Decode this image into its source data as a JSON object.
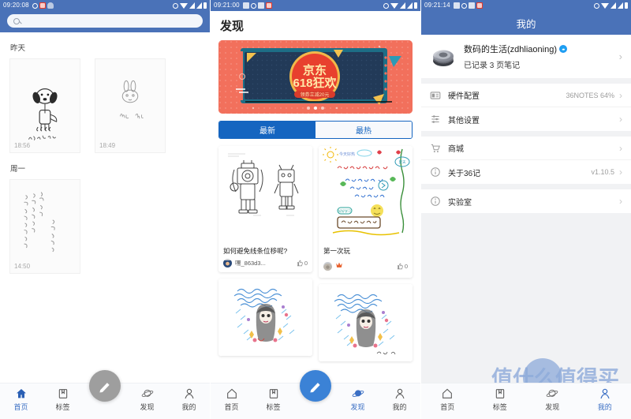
{
  "app": {
    "accent": "#4a72b8",
    "fab_blue": "#3b82d6",
    "fab_grey": "#9e9e9e"
  },
  "panel_home": {
    "statusbar": {
      "clock": "09:20:08",
      "icons_left": [
        "alarm-icon",
        "qq-icon",
        "cloud-icon"
      ],
      "icons_right": [
        "alarm-icon",
        "wifi-icon",
        "signal-icon",
        "signal-icon",
        "battery-icon"
      ]
    },
    "search": {
      "placeholder": "",
      "icon": "search-icon"
    },
    "groups": [
      {
        "title": "昨天",
        "notes": [
          {
            "time": "18:56",
            "thumb": "dog-sketch"
          },
          {
            "time": "18:49",
            "thumb": "rabbit-sketch"
          }
        ]
      },
      {
        "title": "周一",
        "notes": [
          {
            "time": "14:50",
            "thumb": "chinese-calligraphy"
          }
        ]
      }
    ],
    "nav": {
      "items": [
        {
          "label": "首页",
          "icon": "home-icon",
          "active": true
        },
        {
          "label": "标签",
          "icon": "tag-icon",
          "active": false
        },
        {
          "label": "发现",
          "icon": "planet-icon",
          "active": false
        },
        {
          "label": "我的",
          "icon": "person-icon",
          "active": false
        }
      ],
      "fab": {
        "icon": "pencil-icon",
        "color": "#9e9e9e"
      }
    }
  },
  "panel_discover": {
    "statusbar": {
      "clock": "09:21:00"
    },
    "title": "发现",
    "banner": {
      "brand": "京东",
      "headline": "618狂欢",
      "subline": "领券立减20元",
      "dots": 3,
      "active_dot": 2
    },
    "tabs": [
      {
        "label": "最新",
        "selected": true
      },
      {
        "label": "最热",
        "selected": false
      }
    ],
    "cards": [
      {
        "title": "如何避免线条位移呢?",
        "user": "嘿_863d3...",
        "likes": "0",
        "thumb": "robot-sketch"
      },
      {
        "title": "第一次玩",
        "user": "",
        "likes": "0",
        "thumb": "colorful-notes"
      },
      {
        "title": "",
        "user": "",
        "likes": "",
        "thumb": "rain-girl-1"
      },
      {
        "title": "",
        "user": "",
        "likes": "",
        "thumb": "rain-girl-2"
      }
    ],
    "nav": {
      "items": [
        {
          "label": "首页",
          "icon": "home-icon",
          "active": false
        },
        {
          "label": "标签",
          "icon": "tag-icon",
          "active": false
        },
        {
          "label": "发现",
          "icon": "planet-icon",
          "active": true
        },
        {
          "label": "我的",
          "icon": "person-icon",
          "active": false
        }
      ],
      "fab": {
        "icon": "pencil-icon",
        "color": "#3b82d6"
      }
    }
  },
  "panel_mine": {
    "statusbar": {
      "clock": "09:21:14"
    },
    "title": "我的",
    "profile": {
      "name": "数码的生活(zdhliaoning)",
      "badge": "weibo-badge",
      "subtitle": "已记录 3 页笔记",
      "avatar": "gear-photo"
    },
    "sections": [
      {
        "rows": [
          {
            "label": "硬件配置",
            "value": "36NOTES  64%",
            "icon": "device-icon"
          },
          {
            "label": "其他设置",
            "value": "",
            "icon": "sliders-icon"
          }
        ]
      },
      {
        "rows": [
          {
            "label": "商城",
            "value": "",
            "icon": "cart-icon"
          },
          {
            "label": "关于36记",
            "value": "v1.10.5",
            "icon": "info-icon"
          }
        ]
      },
      {
        "rows": [
          {
            "label": "实验室",
            "value": "",
            "icon": "info-icon"
          }
        ]
      }
    ],
    "nav": {
      "items": [
        {
          "label": "首页",
          "icon": "home-icon",
          "active": false
        },
        {
          "label": "标签",
          "icon": "tag-icon",
          "active": false
        },
        {
          "label": "发现",
          "icon": "planet-icon",
          "active": false
        },
        {
          "label": "我的",
          "icon": "person-icon",
          "active": true
        }
      ],
      "fab": null
    },
    "watermark": "值什么值得买"
  }
}
